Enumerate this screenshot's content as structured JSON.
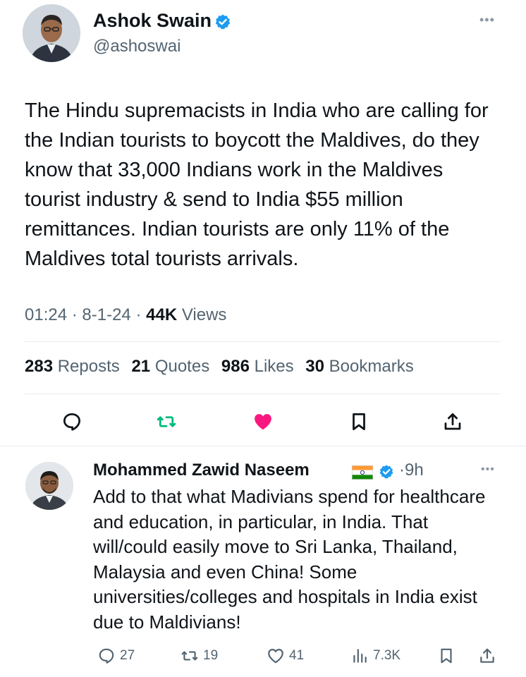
{
  "main_tweet": {
    "author_name": "Ashok Swain",
    "handle": "@ashoswai",
    "more_icon": "more-dots-icon",
    "text": "The Hindu supremacists in India who are calling for the Indian tourists to boycott the Maldives, do they know that 33,000 Indians work in the Maldives tourist industry & send to India $55 million remittances. Indian tourists are only 11% of the Maldives total tourists arrivals.",
    "time": "01:24",
    "date": "8-1-24",
    "sep": "·",
    "views_count": "44K",
    "views_label": "Views",
    "reposts_count": "283",
    "reposts_label": "Reposts",
    "quotes_count": "21",
    "quotes_label": "Quotes",
    "likes_count": "986",
    "likes_label": "Likes",
    "bookmarks_count": "30",
    "bookmarks_label": "Bookmarks",
    "liked": true,
    "like_color": "#f91880",
    "repost_color": "#00ba7c",
    "verified_color": "#1d9bf0"
  },
  "reply": {
    "author_name": "Mohammed Zawid Naseem",
    "time_sep": "·",
    "time": "9h",
    "text": "Add to that what Madivians spend for healthcare and education, in particular, in India. That will/could easily move to Sri Lanka, Thailand, Malaysia and even China! Some universities/colleges and hospitals in India exist due to Maldivians!",
    "replies": "27",
    "reposts": "19",
    "likes": "41",
    "views": "7.3K"
  }
}
